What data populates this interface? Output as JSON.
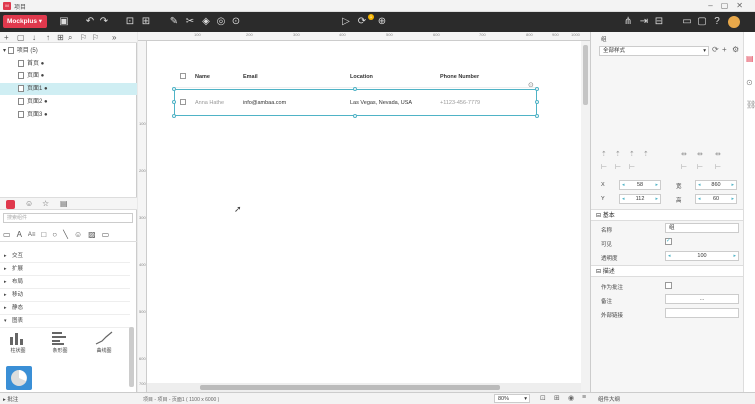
{
  "window": {
    "title": "项目"
  },
  "toolbar": {
    "brand": "Mockplus ▾",
    "left_icons": [
      "save-icon",
      "undo-icon",
      "redo-icon",
      "frame-icon",
      "component-icon",
      "brush-icon",
      "cut-icon",
      "fill-icon",
      "target-icon",
      "export-icon"
    ],
    "center_icons": [
      "play-icon",
      "sync-icon",
      "gift-icon"
    ],
    "right_icons": [
      "share-icon",
      "exit-icon",
      "split-icon",
      "window-icon",
      "help-icon",
      "user-icon"
    ],
    "sync_badge": "1"
  },
  "tree": {
    "tools": [
      "+",
      "▢",
      "↓",
      "↑",
      "⊞",
      "⌕",
      "⚐",
      "⚐",
      "»"
    ],
    "root": "项目 (5)",
    "pages": [
      "首页",
      "页面",
      "页面1",
      "页面2",
      "页面3"
    ],
    "selected_index": 2
  },
  "library": {
    "tabs": [
      "shapes-tab",
      "emoji-icon",
      "star-icon",
      "component-icon"
    ],
    "search_placeholder": "搜索组件",
    "shape_icons": [
      "▭",
      "A",
      "A≡",
      "□",
      "○",
      "╲",
      "☺",
      "▨",
      "▭"
    ],
    "categories": [
      "交互",
      "扩展",
      "布局",
      "移动",
      "静态",
      "图表"
    ],
    "chart_items": [
      "柱状图",
      "条形图",
      "曲线图"
    ]
  },
  "ruler": {
    "top_marks": [
      "100",
      "200",
      "300",
      "400",
      "500",
      "600",
      "700",
      "800",
      "900",
      "1000"
    ],
    "left_marks": [
      "100",
      "200",
      "300",
      "400",
      "500",
      "600",
      "700"
    ]
  },
  "table": {
    "headers": [
      "Name",
      "Email",
      "Location",
      "Phone Number"
    ],
    "row": [
      "Anna Hathe",
      "info@ambaa.com",
      "Las Vegas, Nevada, USA",
      "+1123-456-7779"
    ]
  },
  "inspector": {
    "name_label": "组",
    "style_select": "全部样式",
    "x_label": "X",
    "x_value": "58",
    "y_label": "Y",
    "y_value": "112",
    "w_label": "宽",
    "w_value": "860",
    "h_label": "高",
    "h_value": "60",
    "section_basic": "基本",
    "field_name": "名称",
    "field_name_value": "组",
    "field_visible": "可见",
    "field_opacity": "透明度",
    "opacity_value": "100",
    "section_desc": "描述",
    "field_annotation": "作为批注",
    "field_note": "备注",
    "note_value": "...",
    "field_link": "外部链接"
  },
  "status": {
    "path": "项目 - 项目 - 页面1 ( 1100 x 6000 )",
    "zoom": "80%",
    "left_label": "批注",
    "right_label": "组件大纲"
  },
  "colors": {
    "brand": "#e0394d",
    "accent": "#4fb3c6",
    "toolbar": "#2b2b2b"
  }
}
